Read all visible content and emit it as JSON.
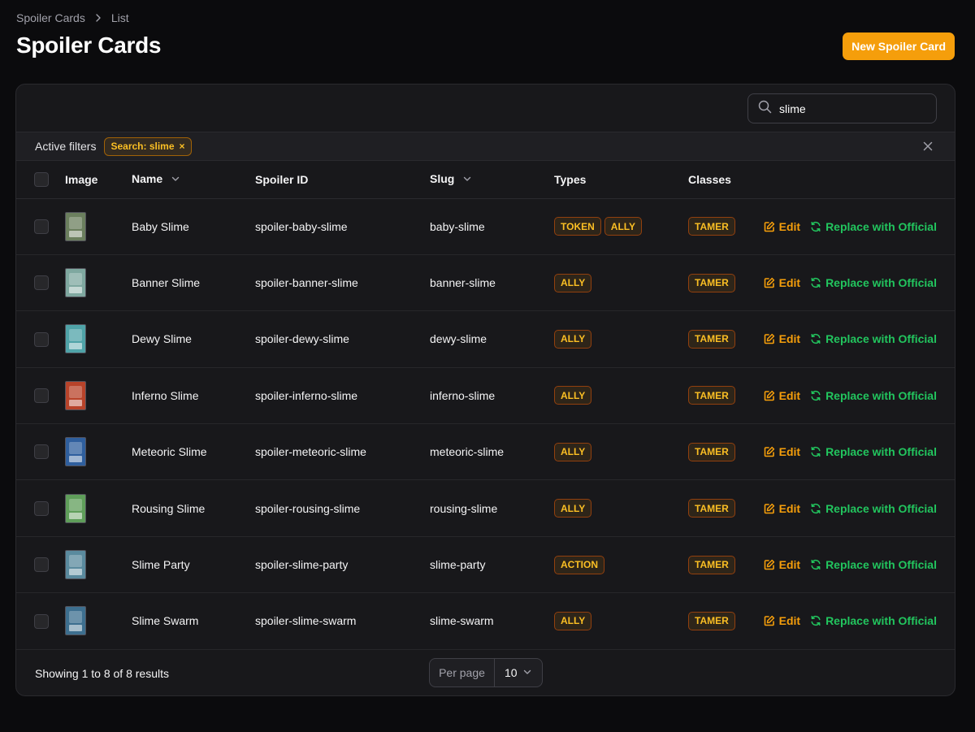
{
  "breadcrumb": {
    "parent": "Spoiler Cards",
    "current": "List"
  },
  "page_title": "Spoiler Cards",
  "new_button_label": "New Spoiler Card",
  "search": {
    "value": "slime"
  },
  "filters": {
    "label": "Active filters",
    "chip_label": "Search: slime",
    "chip_remove": "×"
  },
  "columns": {
    "image": "Image",
    "name": "Name",
    "spoiler_id": "Spoiler ID",
    "slug": "Slug",
    "types": "Types",
    "classes": "Classes"
  },
  "actions": {
    "edit": "Edit",
    "replace": "Replace with Official"
  },
  "rows": [
    {
      "name": "Baby Slime",
      "spoiler_id": "spoiler-baby-slime",
      "slug": "baby-slime",
      "types": [
        "TOKEN",
        "ALLY"
      ],
      "classes": [
        "TAMER"
      ],
      "thumb_color": "#6b7f5e"
    },
    {
      "name": "Banner Slime",
      "spoiler_id": "spoiler-banner-slime",
      "slug": "banner-slime",
      "types": [
        "ALLY"
      ],
      "classes": [
        "TAMER"
      ],
      "thumb_color": "#7fa8a0"
    },
    {
      "name": "Dewy Slime",
      "spoiler_id": "spoiler-dewy-slime",
      "slug": "dewy-slime",
      "types": [
        "ALLY"
      ],
      "classes": [
        "TAMER"
      ],
      "thumb_color": "#4fa3a8"
    },
    {
      "name": "Inferno Slime",
      "spoiler_id": "spoiler-inferno-slime",
      "slug": "inferno-slime",
      "types": [
        "ALLY"
      ],
      "classes": [
        "TAMER"
      ],
      "thumb_color": "#b8432a"
    },
    {
      "name": "Meteoric Slime",
      "spoiler_id": "spoiler-meteoric-slime",
      "slug": "meteoric-slime",
      "types": [
        "ALLY"
      ],
      "classes": [
        "TAMER"
      ],
      "thumb_color": "#2f5f9e"
    },
    {
      "name": "Rousing Slime",
      "spoiler_id": "spoiler-rousing-slime",
      "slug": "rousing-slime",
      "types": [
        "ALLY"
      ],
      "classes": [
        "TAMER"
      ],
      "thumb_color": "#5f9e5a"
    },
    {
      "name": "Slime Party",
      "spoiler_id": "spoiler-slime-party",
      "slug": "slime-party",
      "types": [
        "ACTION"
      ],
      "classes": [
        "TAMER"
      ],
      "thumb_color": "#5a8a9e"
    },
    {
      "name": "Slime Swarm",
      "spoiler_id": "spoiler-slime-swarm",
      "slug": "slime-swarm",
      "types": [
        "ALLY"
      ],
      "classes": [
        "TAMER"
      ],
      "thumb_color": "#3d6f8f"
    }
  ],
  "footer": {
    "summary": "Showing 1 to 8 of 8 results",
    "per_page_label": "Per page",
    "per_page_value": "10"
  },
  "colors": {
    "accent": "#f59e0b",
    "success": "#22c55e",
    "background": "#0b0b0d",
    "panel": "#18181b"
  }
}
